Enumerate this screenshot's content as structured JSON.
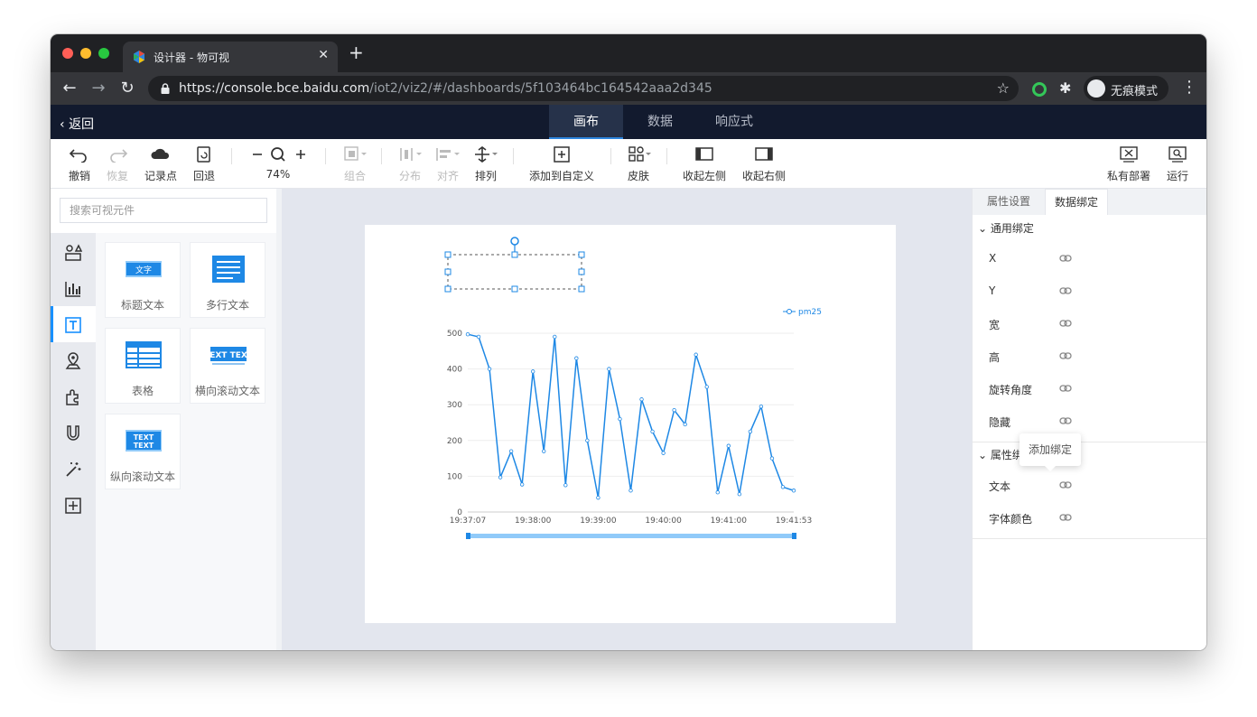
{
  "browser": {
    "tab_title": "设计器 - 物可视",
    "url_base": "https://console.bce.baidu.com",
    "url_path": "/iot2/viz2/#/dashboards/5f103464bc164542aaa2d345",
    "incognito_label": "无痕模式"
  },
  "app_header": {
    "back_label": "返回",
    "tabs": [
      {
        "label": "画布",
        "active": true
      },
      {
        "label": "数据",
        "active": false
      },
      {
        "label": "响应式",
        "active": false
      }
    ]
  },
  "toolbar": {
    "undo": "撤销",
    "redo": "恢复",
    "record": "记录点",
    "rollback": "回退",
    "zoom": "74%",
    "group": "组合",
    "distribute": "分布",
    "align": "对齐",
    "arrange": "排列",
    "add_custom": "添加到自定义",
    "skin": "皮肤",
    "collapse_left": "收起左侧",
    "collapse_right": "收起右侧",
    "private_deploy": "私有部署",
    "run": "运行"
  },
  "left_panel": {
    "search_placeholder": "搜索可视元件",
    "components": [
      {
        "label": "标题文本",
        "thumb_text": "文字"
      },
      {
        "label": "多行文本"
      },
      {
        "label": "表格"
      },
      {
        "label": "横向滚动文本",
        "thumb_text": "EXT TEX"
      },
      {
        "label": "纵向滚动文本",
        "thumb_text": "TEXT"
      }
    ]
  },
  "right_panel": {
    "tabs": [
      {
        "label": "属性设置",
        "active": false
      },
      {
        "label": "数据绑定",
        "active": true
      }
    ],
    "general_section": "通用绑定",
    "general_props": [
      "X",
      "Y",
      "宽",
      "高",
      "旋转角度",
      "隐藏"
    ],
    "attr_section": "属性绑",
    "attr_props": [
      "文本",
      "字体颜色"
    ],
    "tooltip": "添加绑定"
  },
  "colors": {
    "accent": "#1890ff",
    "line": "#1e88e5",
    "header_bg": "#121a2e"
  },
  "chart_data": {
    "type": "line",
    "title": "",
    "legend": "pm25",
    "legend_position": "top-right",
    "xlabel": "",
    "ylabel": "",
    "ylim": [
      0,
      500
    ],
    "yticks": [
      0,
      100,
      200,
      300,
      400,
      500
    ],
    "xticks": [
      "19:37:07",
      "19:38:00",
      "19:39:00",
      "19:40:00",
      "19:41:00",
      "19:41:53"
    ],
    "grid": true,
    "series": [
      {
        "name": "pm25",
        "x_index": [
          0,
          1,
          2,
          3,
          4,
          5,
          6,
          7,
          8,
          9,
          10,
          11,
          12,
          13,
          14,
          15,
          16,
          17,
          18,
          19,
          20,
          21,
          22,
          23,
          24,
          25,
          26,
          27,
          28,
          29,
          30
        ],
        "values": [
          497,
          490,
          400,
          97,
          170,
          77,
          393,
          170,
          490,
          75,
          430,
          200,
          40,
          400,
          260,
          60,
          315,
          225,
          165,
          285,
          245,
          440,
          350,
          55,
          185,
          50,
          225,
          295,
          150,
          70,
          60
        ]
      }
    ]
  }
}
